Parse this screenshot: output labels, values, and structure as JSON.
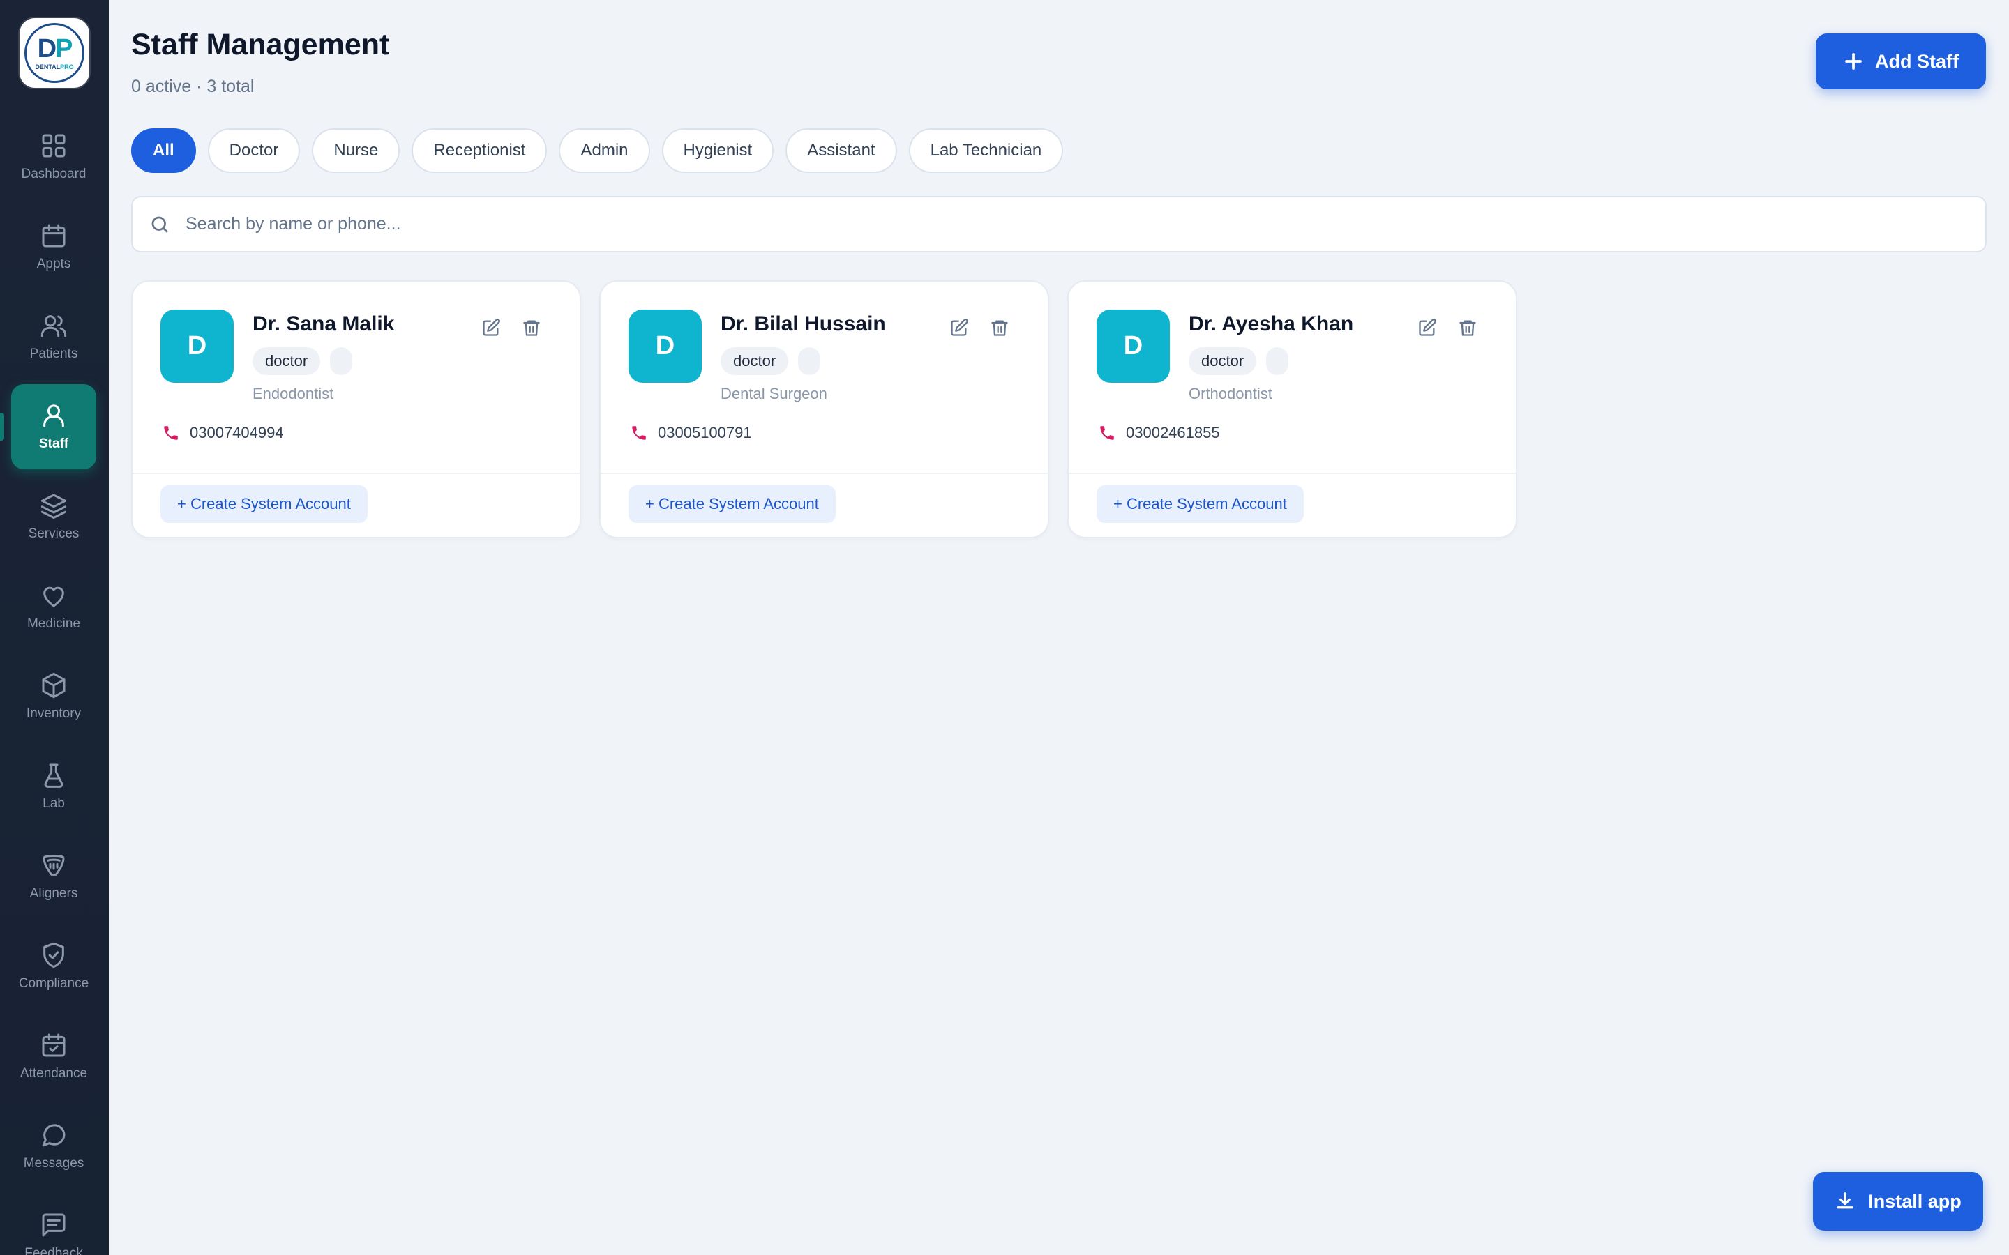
{
  "logo": {
    "mark_left": "D",
    "mark_right": "P",
    "text_left": "DENTAL",
    "text_right": "PRO"
  },
  "sidebar": {
    "items": [
      {
        "label": "Dashboard",
        "icon": "grid-icon"
      },
      {
        "label": "Appts",
        "icon": "calendar-icon"
      },
      {
        "label": "Patients",
        "icon": "users-icon"
      },
      {
        "label": "Staff",
        "icon": "user-icon",
        "active": true
      },
      {
        "label": "Services",
        "icon": "layers-icon"
      },
      {
        "label": "Medicine",
        "icon": "heart-icon"
      },
      {
        "label": "Inventory",
        "icon": "box-icon"
      },
      {
        "label": "Lab",
        "icon": "flask-icon"
      },
      {
        "label": "Aligners",
        "icon": "aligner-icon"
      },
      {
        "label": "Compliance",
        "icon": "shield-check-icon"
      },
      {
        "label": "Attendance",
        "icon": "calendar-check-icon"
      },
      {
        "label": "Messages",
        "icon": "message-circle-icon"
      },
      {
        "label": "Feedback",
        "icon": "message-square-icon"
      }
    ]
  },
  "header": {
    "title": "Staff Management",
    "subtitle": "0 active · 3 total",
    "add_button": "Add Staff"
  },
  "filters": [
    "All",
    "Doctor",
    "Nurse",
    "Receptionist",
    "Admin",
    "Hygienist",
    "Assistant",
    "Lab Technician"
  ],
  "search": {
    "placeholder": "Search by name or phone...",
    "value": ""
  },
  "staff": [
    {
      "initial": "D",
      "name": "Dr. Sana Malik",
      "role": "doctor",
      "specialty": "Endodontist",
      "phone": "03007404994",
      "action": "+ Create System Account"
    },
    {
      "initial": "D",
      "name": "Dr. Bilal Hussain",
      "role": "doctor",
      "specialty": "Dental Surgeon",
      "phone": "03005100791",
      "action": "+ Create System Account"
    },
    {
      "initial": "D",
      "name": "Dr. Ayesha Khan",
      "role": "doctor",
      "specialty": "Orthodontist",
      "phone": "03002461855",
      "action": "+ Create System Account"
    }
  ],
  "install_button": "Install app",
  "colors": {
    "primary": "#1e5fe0",
    "active_nav": "#0f7b72",
    "avatar": "#0fb5cf",
    "phone_icon": "#d21f62",
    "sidebar": "#1a2436"
  }
}
